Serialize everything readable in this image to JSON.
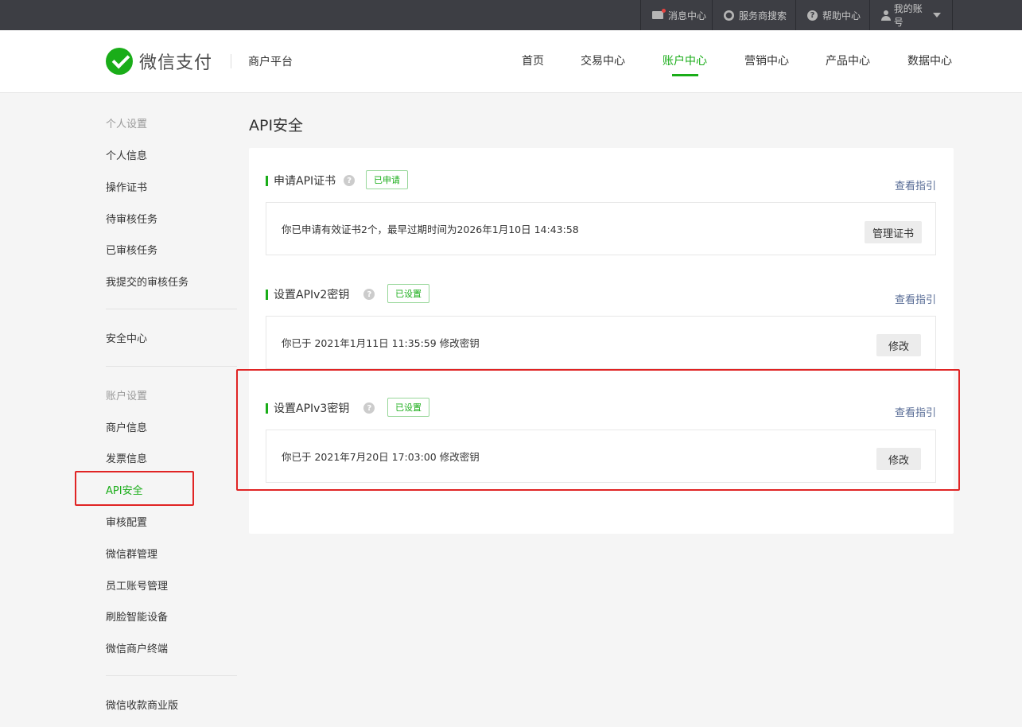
{
  "topbar": {
    "messages": "消息中心",
    "provider_search": "服务商搜索",
    "help": "帮助中心",
    "account": "我的账号"
  },
  "header": {
    "logo_text": "微信支付",
    "platform": "商户平台",
    "nav": [
      "首页",
      "交易中心",
      "账户中心",
      "营销中心",
      "产品中心",
      "数据中心"
    ],
    "active_nav": "账户中心"
  },
  "sidebar": {
    "group1_title": "个人设置",
    "group1_items": [
      "个人信息",
      "操作证书",
      "待审核任务",
      "已审核任务",
      "我提交的审核任务"
    ],
    "security_center": "安全中心",
    "group2_title": "账户设置",
    "group2_items": [
      "商户信息",
      "发票信息",
      "API安全",
      "审核配置",
      "微信群管理",
      "员工账号管理",
      "刷脸智能设备",
      "微信商户终端"
    ],
    "bottom_item": "微信收款商业版",
    "active_item": "API安全"
  },
  "main": {
    "page_title": "API安全",
    "sections": [
      {
        "title": "申请API证书",
        "badge": "已申请",
        "guide": "查看指引",
        "info": "你已申请有效证书2个，最早过期时间为2026年1月10日 14:43:58",
        "button": "管理证书"
      },
      {
        "title": "设置APIv2密钥",
        "badge": "已设置",
        "guide": "查看指引",
        "info": "你已于 2021年1月11日 11:35:59 修改密钥",
        "button": "修改"
      },
      {
        "title": "设置APIv3密钥",
        "badge": "已设置",
        "guide": "查看指引",
        "info": "你已于 2021年7月20日 17:03:00 修改密钥",
        "button": "修改"
      }
    ]
  },
  "colors": {
    "brand_green": "#1aad19",
    "link_blue": "#576b95",
    "highlight_red": "#e02424",
    "topbar_bg": "#3d3e44"
  }
}
